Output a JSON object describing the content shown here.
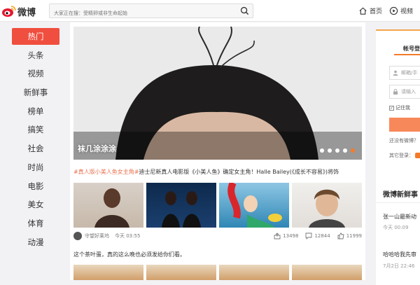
{
  "header": {
    "logo_text": "微博",
    "search_placeholder": "大家正在搜：受精卵或非生命起始",
    "nav": [
      {
        "label": "首页",
        "icon": "home-icon"
      },
      {
        "label": "视频",
        "icon": "video-icon"
      }
    ]
  },
  "sidebar": {
    "items": [
      {
        "label": "热门",
        "active": true
      },
      {
        "label": "头条"
      },
      {
        "label": "视频"
      },
      {
        "label": "新鲜事"
      },
      {
        "label": "榜单"
      },
      {
        "label": "搞笑"
      },
      {
        "label": "社会"
      },
      {
        "label": "时尚"
      },
      {
        "label": "电影"
      },
      {
        "label": "美女"
      },
      {
        "label": "体育"
      },
      {
        "label": "动漫"
      }
    ]
  },
  "main": {
    "hero": {
      "caption": "袜几涂涂涂",
      "dots": 5,
      "active_dot": 5
    },
    "headline": {
      "tag": "#真人版小美人鱼女主角#",
      "text": "迪士尼新真人电影版《小美人鱼》确定女主角！Halle Bailey(《成长不容易》)将饰"
    },
    "meta": {
      "author": "守望好莱坞",
      "time": "今天 03:55",
      "shares": "13498",
      "comments": "12844",
      "likes": "11999"
    },
    "sub_headline": "这个茶叶蛋，真的这么晚也必须发给你们看。"
  },
  "right": {
    "login_tab": "帐号登",
    "username_placeholder": "邮箱/手",
    "password_placeholder": "请输入",
    "remember": "记住我",
    "no_account": "还没有微博？",
    "other_login": "其它登录：",
    "news_title": "微博新鲜事",
    "news": [
      {
        "title": "张一山最新动",
        "time": "今天 00:09"
      },
      {
        "title": "哈哈哈我先审",
        "time": "7月2日 22:46"
      }
    ]
  },
  "colors": {
    "accent": "#f04e3e",
    "orange": "#f47b2a",
    "tag": "#eb7350"
  }
}
